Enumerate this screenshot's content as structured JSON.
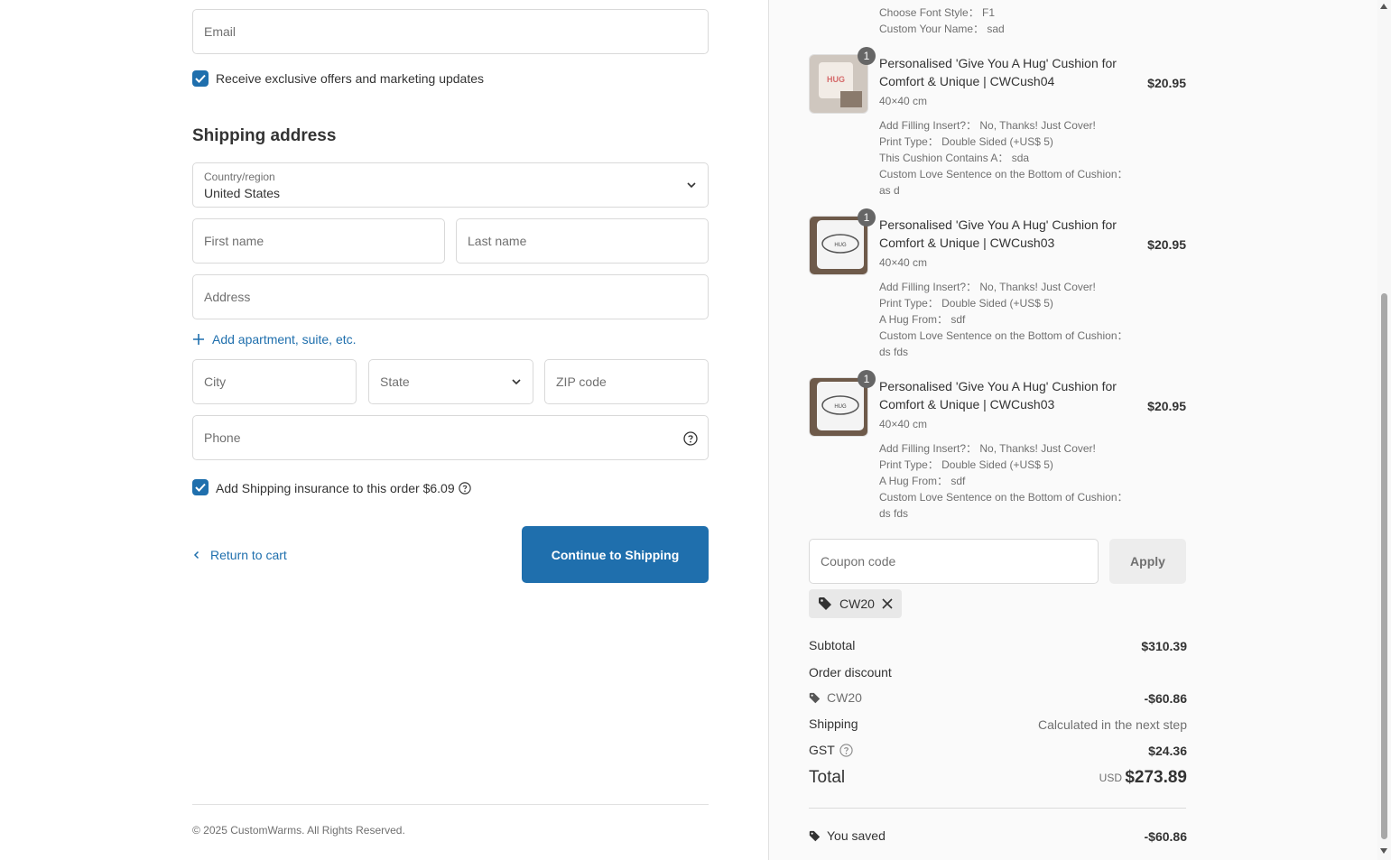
{
  "contact": {
    "email_placeholder": "Email",
    "marketing_label": "Receive exclusive offers and marketing updates"
  },
  "shipping": {
    "title": "Shipping address",
    "country_label": "Country/region",
    "country_value": "United States",
    "first_name_placeholder": "First name",
    "last_name_placeholder": "Last name",
    "address_placeholder": "Address",
    "add_apartment": "Add apartment, suite, etc.",
    "city_placeholder": "City",
    "state_placeholder": "State",
    "zip_placeholder": "ZIP code",
    "phone_placeholder": "Phone",
    "insurance_label": "Add Shipping insurance to this order $6.09"
  },
  "actions": {
    "return_label": "Return to cart",
    "continue_label": "Continue to Shipping"
  },
  "footer": {
    "copyright": "© 2025 CustomWarms. All Rights Reserved."
  },
  "order": {
    "top_options": [
      "Choose Font Style： F1",
      "Custom Your Name： sad"
    ],
    "items": [
      {
        "qty": "1",
        "title": "Personalised 'Give You A Hug' Cushion for Comfort & Unique | CWCush04",
        "size": "40×40 cm",
        "price": "$20.95",
        "options": [
          "Add Filling Insert?： No, Thanks! Just Cover!",
          "Print Type： Double Sided (+US$ 5)",
          "This Cushion Contains A： sda",
          "Custom Love Sentence on the Bottom of Cushion： as d"
        ]
      },
      {
        "qty": "1",
        "title": "Personalised 'Give You A Hug' Cushion for Comfort & Unique | CWCush03",
        "size": "40×40 cm",
        "price": "$20.95",
        "options": [
          "Add Filling Insert?： No, Thanks! Just Cover!",
          "Print Type： Double Sided (+US$ 5)",
          "A Hug From： sdf",
          "Custom Love Sentence on the Bottom of Cushion： ds fds"
        ]
      },
      {
        "qty": "1",
        "title": "Personalised 'Give You A Hug' Cushion for Comfort & Unique | CWCush03",
        "size": "40×40 cm",
        "price": "$20.95",
        "options": [
          "Add Filling Insert?： No, Thanks! Just Cover!",
          "Print Type： Double Sided (+US$ 5)",
          "A Hug From： sdf",
          "Custom Love Sentence on the Bottom of Cushion： ds fds"
        ]
      }
    ],
    "coupon_placeholder": "Coupon code",
    "apply_label": "Apply",
    "applied_code": "CW20",
    "summary": {
      "subtotal_label": "Subtotal",
      "subtotal_value": "$310.39",
      "discount_label": "Order discount",
      "discount_code": "CW20",
      "discount_value": "-$60.86",
      "shipping_label": "Shipping",
      "shipping_value": "Calculated in the next step",
      "gst_label": "GST",
      "gst_value": "$24.36",
      "total_label": "Total",
      "total_currency": "USD",
      "total_value": "$273.89",
      "saved_label": "You saved",
      "saved_value": "-$60.86"
    }
  },
  "colors": {
    "accent": "#1f6fad",
    "muted": "#707070"
  }
}
